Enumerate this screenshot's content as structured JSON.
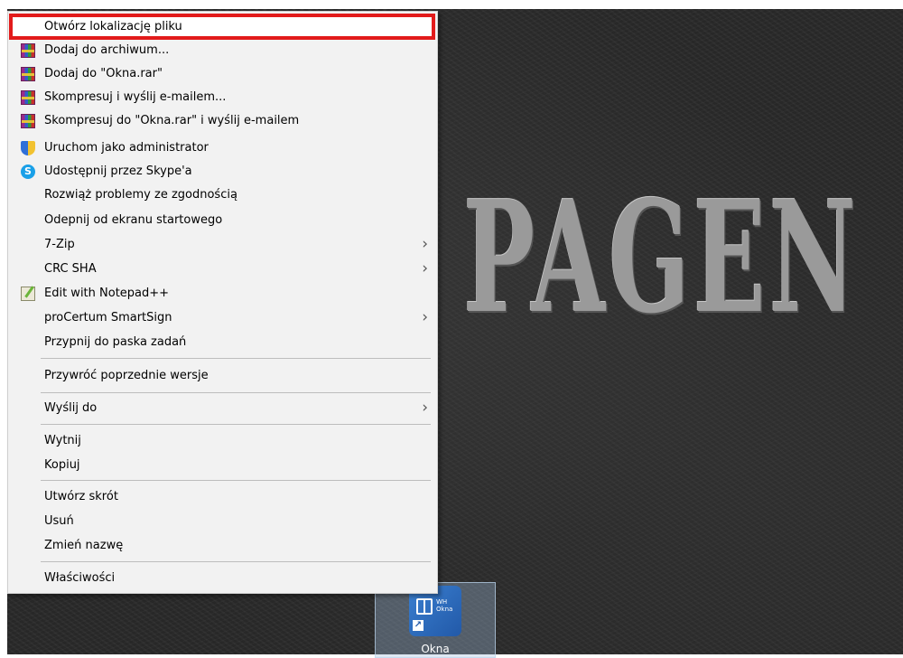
{
  "desktop": {
    "wallpaper_text": "PAGEN",
    "icon": {
      "label": "Okna",
      "tile_text": "WH Okna"
    }
  },
  "context_menu": {
    "items": [
      {
        "label": "Otwórz lokalizację pliku",
        "icon": null,
        "submenu": false,
        "highlighted": true
      },
      {
        "label": "Dodaj do archiwum...",
        "icon": "winrar-icon",
        "submenu": false
      },
      {
        "label": "Dodaj do \"Okna.rar\"",
        "icon": "winrar-icon",
        "submenu": false
      },
      {
        "label": "Skompresuj i wyślij e-mailem...",
        "icon": "winrar-icon",
        "submenu": false
      },
      {
        "label": "Skompresuj do \"Okna.rar\" i wyślij e-mailem",
        "icon": "winrar-icon",
        "submenu": false
      },
      {
        "label": "Uruchom jako administrator",
        "icon": "uac-shield-icon",
        "submenu": false
      },
      {
        "label": "Udostępnij przez Skype'a",
        "icon": "skype-icon",
        "submenu": false
      },
      {
        "label": "Rozwiąż problemy ze zgodnością",
        "icon": null,
        "submenu": false
      },
      {
        "label": "Odepnij od ekranu startowego",
        "icon": null,
        "submenu": false
      },
      {
        "label": "7-Zip",
        "icon": null,
        "submenu": true
      },
      {
        "label": "CRC SHA",
        "icon": null,
        "submenu": true
      },
      {
        "label": "Edit with Notepad++",
        "icon": "notepad-plus-plus-icon",
        "submenu": false
      },
      {
        "label": "proCertum SmartSign",
        "icon": null,
        "submenu": true
      },
      {
        "label": "Przypnij do paska zadań",
        "icon": null,
        "submenu": false
      },
      {
        "label": "Przywróć poprzednie wersje",
        "icon": null,
        "submenu": false
      },
      {
        "label": "Wyślij do",
        "icon": null,
        "submenu": true
      },
      {
        "label": "Wytnij",
        "icon": null,
        "submenu": false
      },
      {
        "label": "Kopiuj",
        "icon": null,
        "submenu": false
      },
      {
        "label": "Utwórz skrót",
        "icon": null,
        "submenu": false
      },
      {
        "label": "Usuń",
        "icon": null,
        "submenu": false
      },
      {
        "label": "Zmień nazwę",
        "icon": null,
        "submenu": false
      },
      {
        "label": "Właściwości",
        "icon": null,
        "submenu": false
      }
    ],
    "highlight_color": "#e21b1b"
  },
  "skype_glyph": "S",
  "chevron_glyph": "›"
}
